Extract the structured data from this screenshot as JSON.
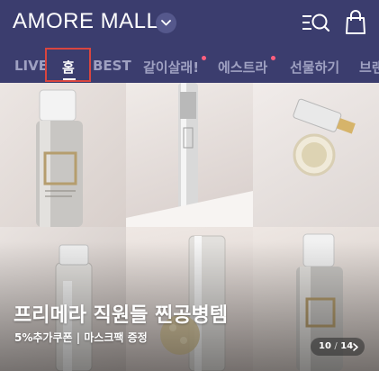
{
  "header": {
    "logo": "AMORE MALL"
  },
  "nav": {
    "items": [
      {
        "label": "LIVE",
        "active": false,
        "dot": false
      },
      {
        "label": "홈",
        "active": true,
        "dot": false
      },
      {
        "label": "BEST",
        "active": false,
        "dot": false
      },
      {
        "label": "같이살래!",
        "active": false,
        "dot": true
      },
      {
        "label": "에스트라",
        "active": false,
        "dot": true
      },
      {
        "label": "선물하기",
        "active": false,
        "dot": false
      },
      {
        "label": "브랜",
        "active": false,
        "dot": false
      }
    ]
  },
  "banner": {
    "title": "프리메라 직원들 찐공병템",
    "subtitle": "5%추가쿠폰 | 마스크팩 증정",
    "current": "10",
    "separator": "/",
    "total": "14"
  },
  "colors": {
    "header_bg": "#3b3d6e",
    "nav_inactive": "#9fa1c2",
    "nav_active": "#ffffff",
    "new_dot": "#ff5f7e",
    "focus_outline": "#d9453f"
  }
}
